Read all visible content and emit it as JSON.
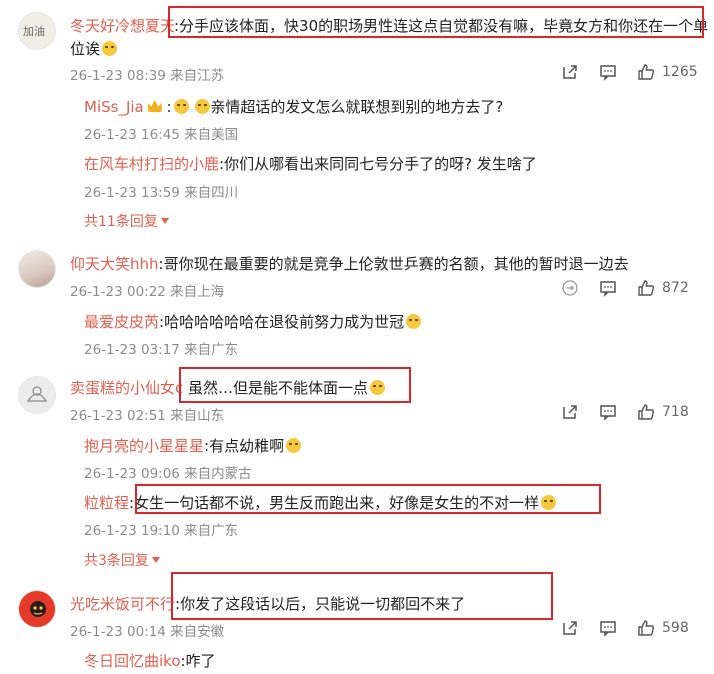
{
  "comments": [
    {
      "user": "冬天好冷想夏天",
      "text_line1": ":分手应该体面，快30的职场男性连这点自觉都没有嘛，毕竟女方和你还在一个单",
      "text_line2": "位诶",
      "meta": "26-1-23 08:39 来自江苏",
      "likes": "1265",
      "replies": [
        {
          "user": "MiSs_Jia",
          "text": "亲情超话的发文怎么就联想到别的地方去了?",
          "meta": "26-1-23 16:45 来自美国"
        },
        {
          "user": "在风车村打扫的小鹿",
          "text": ":你们从哪看出来同同七号分手了的呀? 发生啥了",
          "meta": "26-1-23 13:59 来自四川"
        }
      ],
      "more_replies": "共11条回复"
    },
    {
      "user": "仰天大笑hhh",
      "text_line1": ":哥你现在最重要的就是竞争上伦敦世乒赛的名额，其他的暂时退一边去",
      "meta": "26-1-23 00:22 来自上海",
      "likes": "872",
      "replies": [
        {
          "user": "最爱皮皮芮",
          "text": ":哈哈哈哈哈哈在退役前努力成为世冠",
          "meta": "26-1-23 03:17 来自广东"
        }
      ]
    },
    {
      "user": "卖蛋糕的小仙女c",
      "text_line1": "虽然…但是能不能体面一点",
      "meta": "26-1-23 02:51 来自山东",
      "likes": "718",
      "replies": [
        {
          "user": "抱月亮的小星星星",
          "text": ":有点幼稚啊",
          "meta": "26-1-23 09:06 来自内蒙古"
        },
        {
          "user": "粒粒程",
          "text": ":女生一句话都不说，男生反而跑出来，好像是女生的不对一样",
          "meta": "26-1-23 19:10 来自广东"
        }
      ],
      "more_replies": "共3条回复"
    },
    {
      "user": "光吃米饭可不行",
      "text_line1": ":你发了这段话以后，只能说一切都回不来了",
      "meta": "26-1-23 00:14 来自安徽",
      "likes": "598",
      "replies": [
        {
          "user": "冬日回忆曲iko",
          "text": ":咋了"
        }
      ]
    }
  ],
  "icons": {
    "share": "share-icon",
    "comment": "comment-icon",
    "like": "thumbs-up-icon",
    "retweet": "retweet-icon",
    "emoji": "laugh-emoji-icon",
    "crown": "crown-badge-icon",
    "more_caret": "caret-down-icon"
  },
  "colors": {
    "username": "#e1604f",
    "meta": "#8c8c8c",
    "highlight_box": "#d9252c"
  }
}
